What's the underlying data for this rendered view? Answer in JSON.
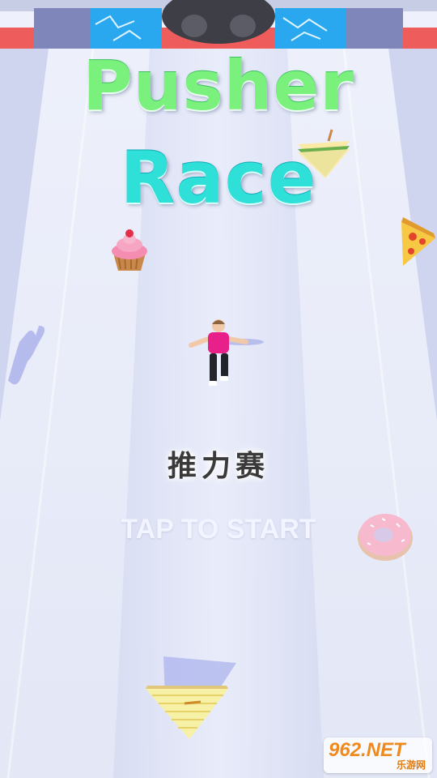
{
  "game": {
    "title_line1": "Pusher",
    "title_line2": "Race",
    "subtitle": "推力赛",
    "prompt": "TAP TO START"
  },
  "watermark": {
    "main": "962.NET",
    "sub": "乐游网"
  },
  "colors": {
    "track": "#e6eafa",
    "lane": "#d6dbf3",
    "title_line1": "#7af07d",
    "title_line2": "#2ee0d8",
    "player_shirt": "#e8208a",
    "finish_blue": "#29a8f0",
    "finish_red": "#ef5c5c"
  },
  "icons": [
    "cupcake-icon",
    "pizza-slice-icon",
    "sandwich-icon",
    "donut-icon",
    "runner-character"
  ]
}
